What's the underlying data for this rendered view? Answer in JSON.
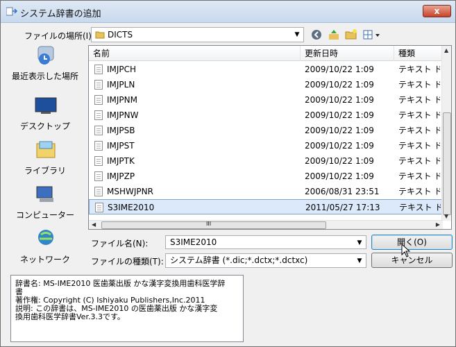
{
  "window": {
    "title": "システム辞書の追加",
    "close_label": "x"
  },
  "location": {
    "label": "ファイルの場所(I):",
    "value": "DICTS"
  },
  "places": [
    {
      "label": "最近表示した場所",
      "icon": "recent-places-icon"
    },
    {
      "label": "デスクトップ",
      "icon": "desktop-icon"
    },
    {
      "label": "ライブラリ",
      "icon": "libraries-icon"
    },
    {
      "label": "コンピューター",
      "icon": "computer-icon"
    },
    {
      "label": "ネットワーク",
      "icon": "network-icon"
    }
  ],
  "list": {
    "headers": {
      "name": "名前",
      "modified": "更新日時",
      "type": "種類"
    },
    "rows": [
      {
        "name": "IMJPCH",
        "modified": "2009/10/22 1:09",
        "type": "テキスト ドキュメント"
      },
      {
        "name": "IMJPLN",
        "modified": "2009/10/22 1:09",
        "type": "テキスト ドキュメント"
      },
      {
        "name": "IMJPNM",
        "modified": "2009/10/22 1:09",
        "type": "テキスト ドキュメント"
      },
      {
        "name": "IMJPNW",
        "modified": "2009/10/22 1:09",
        "type": "テキスト ドキュメント"
      },
      {
        "name": "IMJPSB",
        "modified": "2009/10/22 1:09",
        "type": "テキスト ドキュメント"
      },
      {
        "name": "IMJPST",
        "modified": "2009/10/22 1:09",
        "type": "テキスト ドキュメント"
      },
      {
        "name": "IMJPTK",
        "modified": "2009/10/22 1:09",
        "type": "テキスト ドキュメント"
      },
      {
        "name": "IMJPZP",
        "modified": "2009/10/22 1:09",
        "type": "テキスト ドキュメント"
      },
      {
        "name": "MSHWJPNR",
        "modified": "2006/08/31 23:51",
        "type": "テキスト ドキュメント"
      },
      {
        "name": "S3IME2010",
        "modified": "2011/05/27 17:13",
        "type": "テキスト ドキュメント",
        "selected": true
      }
    ],
    "hscroll_label": "III"
  },
  "filename": {
    "label": "ファイル名(N):",
    "value": "S3IME2010"
  },
  "filetype": {
    "label": "ファイルの種類(T):",
    "value": "システム辞書 (*.dic;*.dctx;*.dctxc)"
  },
  "buttons": {
    "open": "開く(O)",
    "cancel": "キャンセル"
  },
  "description": "辞書名: MS-IME2010 医歯薬出版 かな漢字変換用歯科医学辞\n書\n著作権: Copyright (C) Ishiyaku Publishers,Inc.2011\n説明: この辞書は、MS-IME2010 の医歯薬出版 かな漢字変\n換用歯科医学辞書Ver.3.3です。",
  "colors": {
    "selection": "#dbe9fb",
    "close": "#c7432a"
  }
}
